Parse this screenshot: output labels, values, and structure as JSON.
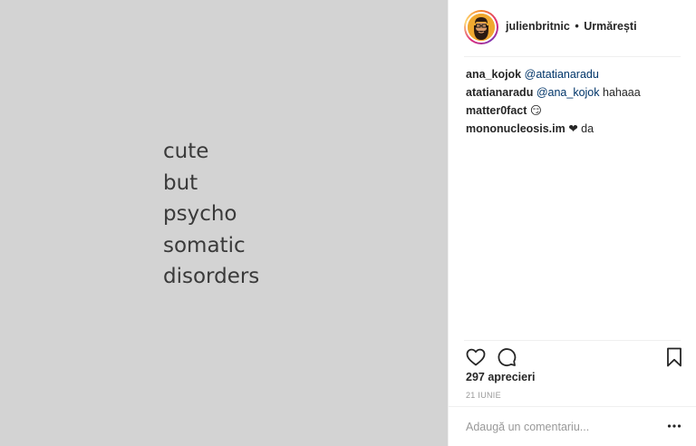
{
  "media": {
    "lines": [
      "cute",
      "but",
      "psycho",
      "somatic",
      "disorders"
    ],
    "background": "#d3d3d3"
  },
  "header": {
    "username": "julienbritnic",
    "separator": "•",
    "follow_label": "Urmărești"
  },
  "comments": [
    {
      "user": "ana_kojok",
      "mention": "@atatianaradu",
      "text": ""
    },
    {
      "user": "atatianaradu",
      "mention": "@ana_kojok",
      "text": " hahaaa"
    },
    {
      "user": "matter0fact",
      "mention": "",
      "text": " 😏"
    },
    {
      "user": "mononucleosis.im",
      "mention": "",
      "text": " ❤ da"
    }
  ],
  "actions": {
    "icons": [
      "heart-icon",
      "comment-icon",
      "bookmark-icon"
    ]
  },
  "likes_label": "297 aprecieri",
  "date_label": "21 IUNIE",
  "add_comment": {
    "placeholder": "Adaugă un comentariu...",
    "value": ""
  },
  "more_icon": "ellipsis-icon"
}
